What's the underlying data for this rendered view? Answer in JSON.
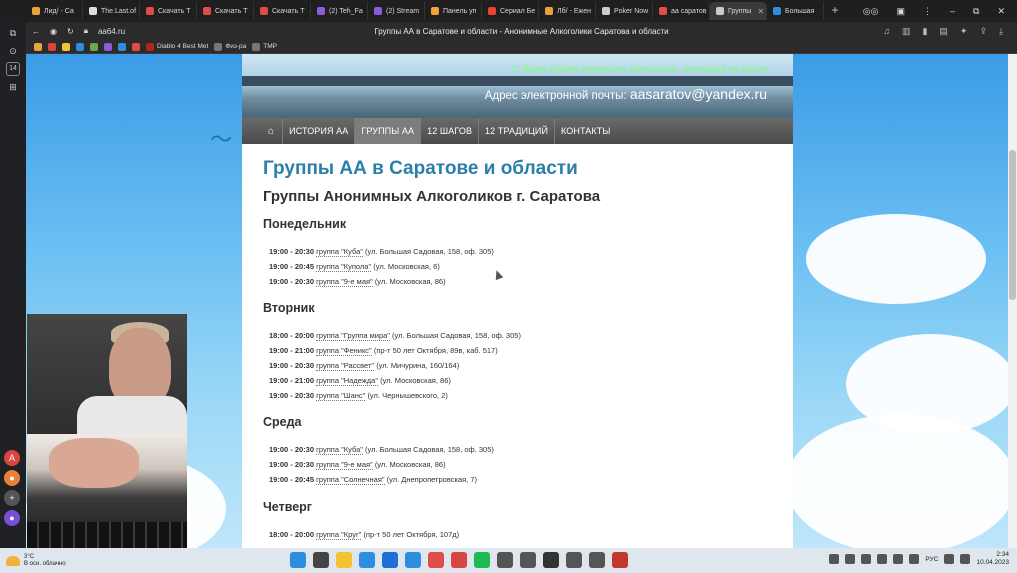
{
  "browser": {
    "tabs": [
      {
        "label": "Лид/ - Са",
        "color": "#e8a33c"
      },
      {
        "label": "The.Last.of",
        "color": "#dddddd"
      },
      {
        "label": "Скачать Т",
        "color": "#e04b4b"
      },
      {
        "label": "Скачать Т",
        "color": "#e04b4b"
      },
      {
        "label": "Скачать Т",
        "color": "#e04b4b"
      },
      {
        "label": "(2) Teh_Fa",
        "color": "#8a5cd8"
      },
      {
        "label": "(2) Stream",
        "color": "#8a5cd8"
      },
      {
        "label": "Панель уп",
        "color": "#f2a23a"
      },
      {
        "label": "Сериал Бе",
        "color": "#e6452f"
      },
      {
        "label": "Лб/ - Ежен",
        "color": "#e8a33c"
      },
      {
        "label": "Poker Now",
        "color": "#cccccc"
      },
      {
        "label": "аа саратов",
        "color": "#e04b4b"
      },
      {
        "label": "Группы",
        "color": "#cccccc",
        "active": true
      },
      {
        "label": "Большая",
        "color": "#2d8ee0"
      }
    ],
    "url": "aa64.ru",
    "page_title": "Группы АА в Саратове и области - Анонимные Алкоголики Саратова и области",
    "bookmarks": [
      {
        "label": "",
        "color": "#e8a33c"
      },
      {
        "label": "",
        "color": "#d9463f"
      },
      {
        "label": "",
        "color": "#f1c232"
      },
      {
        "label": "",
        "color": "#2d8ee0"
      },
      {
        "label": "",
        "color": "#6aa84f"
      },
      {
        "label": "",
        "color": "#8a5cd8"
      },
      {
        "label": "",
        "color": "#2d8ee0"
      },
      {
        "label": "",
        "color": "#e04b4b"
      },
      {
        "label": "Diablo 4 Best Met",
        "color": "#b22222"
      },
      {
        "label": "Физ-ра",
        "color": "#777777"
      },
      {
        "label": "TMP",
        "color": "#777777"
      }
    ]
  },
  "site": {
    "tagline": "С Вами будет говорить алкоголик, который не пьет",
    "email_label": "Адрес электронной почты:",
    "email": "aasaratov@yandex.ru",
    "nav": {
      "home": "⌂",
      "items": [
        "ИСТОРИЯ АА",
        "ГРУППЫ АА",
        "12 ШАГОВ",
        "12 ТРАДИЦИЙ",
        "КОНТАКТЫ"
      ],
      "active_index": 1
    },
    "title": "Группы АА в Саратове и области",
    "subtitle": "Группы Анонимных Алкоголиков г. Саратова",
    "days": [
      {
        "name": "Понедельник",
        "meetings": [
          {
            "time": "19:00 - 20:30",
            "group": "группа \"Куба\"",
            "address": "(ул. Большая Садовая, 158, оф. 305)"
          },
          {
            "time": "19:00 - 20:45",
            "group": "группа \"Купола\"",
            "address": "(ул. Московская, 6)"
          },
          {
            "time": "19:00 - 20:30",
            "group": "группа \"9-е мая\"",
            "address": "(ул. Московская, 86)"
          }
        ]
      },
      {
        "name": "Вторник",
        "meetings": [
          {
            "time": "18:00 - 20:00",
            "group": "группа \"Группа мира\"",
            "address": "(ул. Большая Садовая, 158, оф. 305)"
          },
          {
            "time": "19:00 - 21:00",
            "group": "группа \"Феникс\"",
            "address": "(пр-т 50 лет Октября, 89в, каб. 517)"
          },
          {
            "time": "19:00 - 20:30",
            "group": "группа \"Рассвет\"",
            "address": "(ул. Мичурина, 160/164)"
          },
          {
            "time": "19:00 - 21:00",
            "group": "группа \"Надежда\"",
            "address": "(ул. Московская, 86)"
          },
          {
            "time": "19:00 - 20:30",
            "group": "группа \"Шанс\"",
            "address": "(ул. Чернышевского, 2)"
          }
        ]
      },
      {
        "name": "Среда",
        "meetings": [
          {
            "time": "19:00 - 20:30",
            "group": "группа \"Куба\"",
            "address": "(ул. Большая Садовая, 158, оф. 305)"
          },
          {
            "time": "19:00 - 20:30",
            "group": "группа \"9-е мая\"",
            "address": "(ул. Московская, 86)"
          },
          {
            "time": "19:00 - 20:45",
            "group": "группа \"Солнечная\"",
            "address": "(ул. Днепропетровская, 7)"
          }
        ]
      },
      {
        "name": "Четверг",
        "meetings": [
          {
            "time": "18:00 - 20:00",
            "group": "группа \"Круг\"",
            "address": "(пр-т 50 лет Октября, 107д)"
          }
        ]
      }
    ]
  },
  "taskbar": {
    "weather_temp": "3°C",
    "weather_desc": "В осн. облачно",
    "lang": "РУС",
    "time": "2:34",
    "date": "10.04.2023",
    "app_colors": [
      "#2d8ee0",
      "#444444",
      "#f1c232",
      "#2d8ee0",
      "#1f6fd6",
      "#2d8ee0",
      "#e04b4b",
      "#d9463f",
      "#1db954",
      "#555555",
      "#555555",
      "#333333",
      "#555555",
      "#555555",
      "#c0392b"
    ]
  },
  "side_panel": {
    "icons": [
      "tabs-icon",
      "history-icon",
      "badge-icon",
      "collections-icon"
    ],
    "badge_text": "14"
  }
}
